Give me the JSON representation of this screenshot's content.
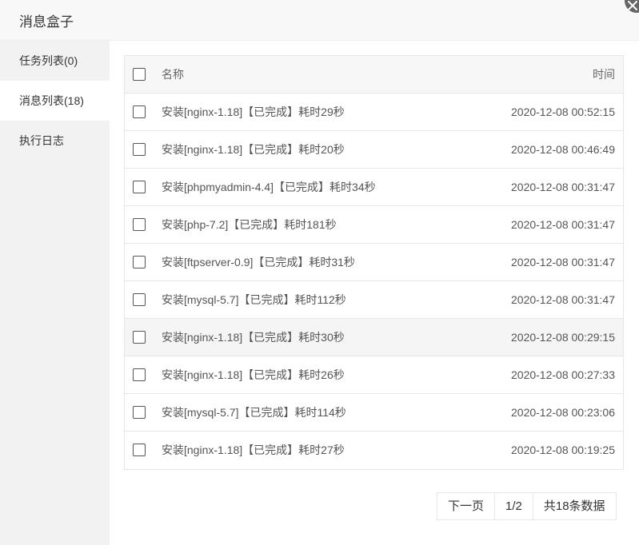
{
  "header": {
    "title": "消息盒子"
  },
  "sidebar": {
    "items": [
      {
        "label": "任务列表(0)"
      },
      {
        "label": "消息列表(18)"
      },
      {
        "label": "执行日志"
      }
    ]
  },
  "table": {
    "columns": {
      "name": "名称",
      "time": "时间"
    },
    "rows": [
      {
        "name": "安装[nginx-1.18]【已完成】耗时29秒",
        "time": "2020-12-08 00:52:15"
      },
      {
        "name": "安装[nginx-1.18]【已完成】耗时20秒",
        "time": "2020-12-08 00:46:49"
      },
      {
        "name": "安装[phpmyadmin-4.4]【已完成】耗时34秒",
        "time": "2020-12-08 00:31:47"
      },
      {
        "name": "安装[php-7.2]【已完成】耗时181秒",
        "time": "2020-12-08 00:31:47"
      },
      {
        "name": "安装[ftpserver-0.9]【已完成】耗时31秒",
        "time": "2020-12-08 00:31:47"
      },
      {
        "name": "安装[mysql-5.7]【已完成】耗时112秒",
        "time": "2020-12-08 00:31:47"
      },
      {
        "name": "安装[nginx-1.18]【已完成】耗时30秒",
        "time": "2020-12-08 00:29:15"
      },
      {
        "name": "安装[nginx-1.18]【已完成】耗时26秒",
        "time": "2020-12-08 00:27:33"
      },
      {
        "name": "安装[mysql-5.7]【已完成】耗时114秒",
        "time": "2020-12-08 00:23:06"
      },
      {
        "name": "安装[nginx-1.18]【已完成】耗时27秒",
        "time": "2020-12-08 00:19:25"
      }
    ]
  },
  "pager": {
    "next_label": "下一页",
    "page": "1/2",
    "total": "共18条数据"
  }
}
